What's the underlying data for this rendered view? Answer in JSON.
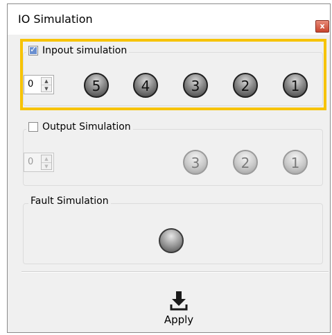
{
  "window": {
    "title": "IO Simulation",
    "close_label": "x"
  },
  "input_sim": {
    "label": "Inpout simulation",
    "checked": true,
    "spinner_value": "0",
    "leds": [
      "5",
      "4",
      "3",
      "2",
      "1"
    ]
  },
  "output_sim": {
    "label": "Output Simulation",
    "checked": false,
    "spinner_value": "0",
    "leds": [
      "3",
      "2",
      "1"
    ]
  },
  "fault_sim": {
    "label": "Fault Simulation"
  },
  "apply": {
    "label": "Apply"
  },
  "colors": {
    "highlight": "#f7c300",
    "close_button": "#c8442c"
  }
}
